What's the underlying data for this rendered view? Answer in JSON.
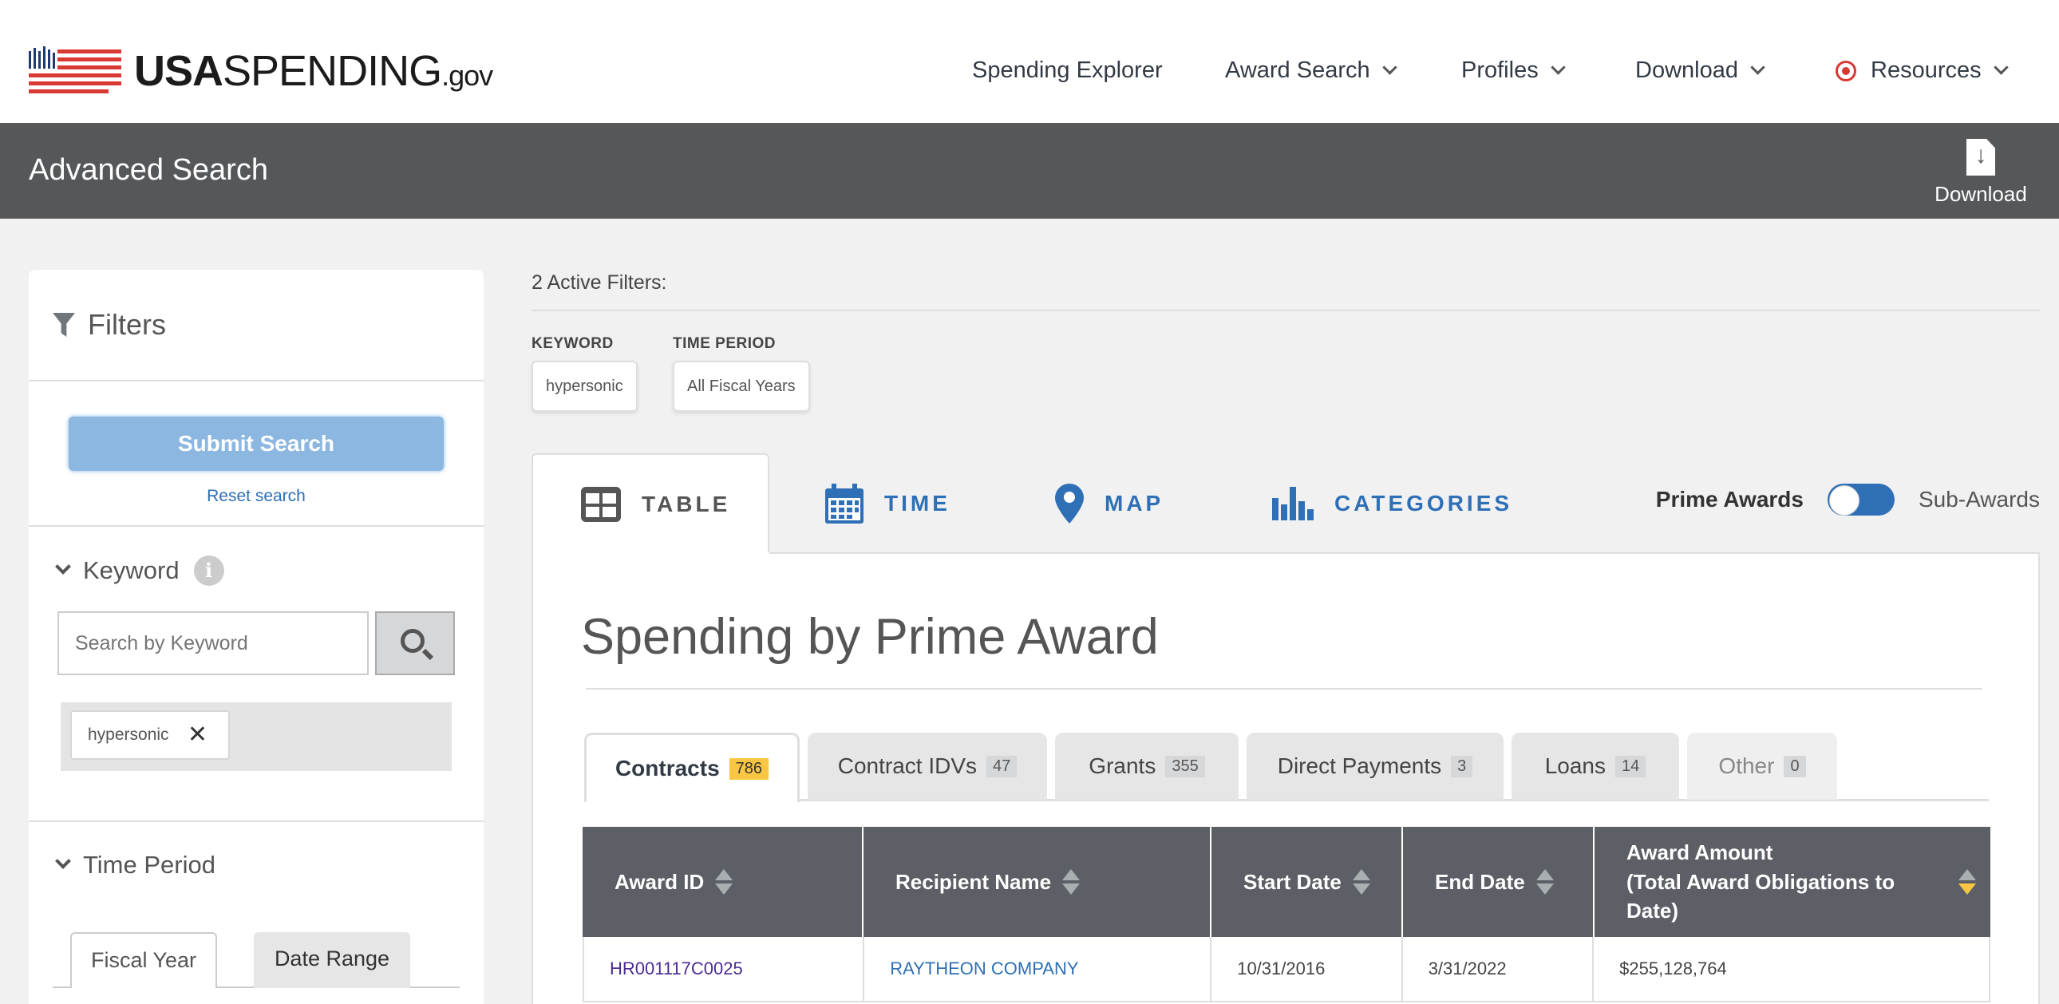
{
  "brand": {
    "logo_bold": "USA",
    "logo_rest": "SPENDING",
    "logo_tld": ".gov"
  },
  "nav": {
    "items": [
      {
        "label": "Spending Explorer"
      },
      {
        "label": "Award Search"
      },
      {
        "label": "Profiles"
      },
      {
        "label": "Download"
      },
      {
        "label": "Resources"
      }
    ]
  },
  "search_header": {
    "title": "Advanced Search",
    "download_label": "Download"
  },
  "sidebar": {
    "title": "Filters",
    "submit_label": "Submit Search",
    "reset_label": "Reset search",
    "keyword": {
      "title": "Keyword",
      "info_icon": "i",
      "placeholder": "Search by Keyword",
      "chip": "hypersonic"
    },
    "time_period": {
      "title": "Time Period",
      "tabs": [
        "Fiscal Year",
        "Date Range"
      ]
    }
  },
  "active_filters": {
    "heading": "2 Active Filters:",
    "groups": [
      {
        "label": "KEYWORD",
        "value": "hypersonic"
      },
      {
        "label": "TIME PERIOD",
        "value": "All Fiscal Years"
      }
    ]
  },
  "viz_tabs": [
    {
      "label": "TABLE",
      "icon": "table-icon"
    },
    {
      "label": "TIME",
      "icon": "calendar-icon"
    },
    {
      "label": "MAP",
      "icon": "map-pin-icon"
    },
    {
      "label": "CATEGORIES",
      "icon": "bar-chart-icon"
    }
  ],
  "award_toggle": {
    "left": "Prime Awards",
    "right": "Sub-Awards"
  },
  "results": {
    "title": "Spending by Prime Award",
    "type_tabs": [
      {
        "label": "Contracts",
        "count": "786"
      },
      {
        "label": "Contract IDVs",
        "count": "47"
      },
      {
        "label": "Grants",
        "count": "355"
      },
      {
        "label": "Direct Payments",
        "count": "3"
      },
      {
        "label": "Loans",
        "count": "14"
      },
      {
        "label": "Other",
        "count": "0"
      }
    ],
    "columns": [
      "Award ID",
      "Recipient Name",
      "Start Date",
      "End Date",
      "Award Amount",
      "(Total Award Obligations to Date)"
    ],
    "rows": [
      {
        "award_id": "HR001117C0025",
        "recipient": "RAYTHEON COMPANY",
        "start": "10/31/2016",
        "end": "3/31/2022",
        "amount": "$255,128,764"
      }
    ]
  },
  "colors": {
    "header_bar": "#555759",
    "accent_blue": "#2e6fb5",
    "highlight": "#f9c642",
    "table_header": "#5c5f66"
  }
}
